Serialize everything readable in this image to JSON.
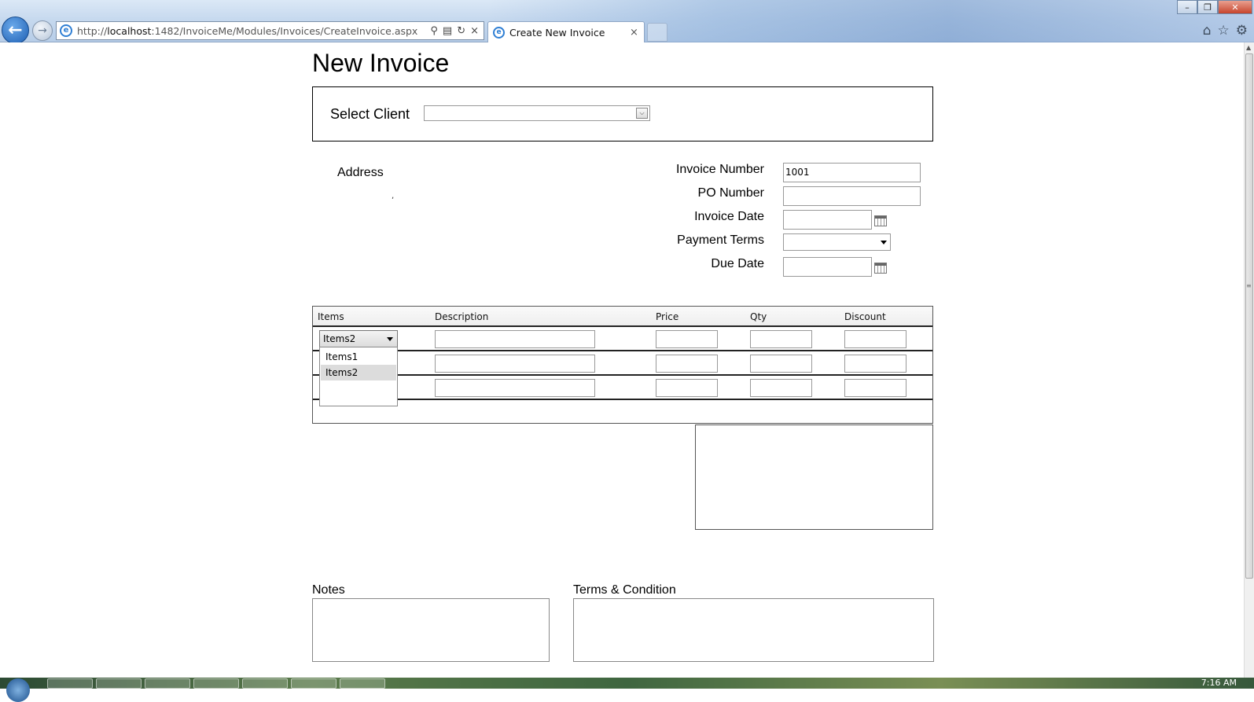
{
  "browser": {
    "url_prefix": "http://",
    "url_host": "localhost",
    "url_rest": ":1482/InvoiceMe/Modules/Invoices/CreateInvoice.aspx",
    "tab_title": "Create New Invoice",
    "tab_close": "×",
    "back_glyph": "←",
    "forward_glyph": "→",
    "search_glyph": "⚲",
    "refresh_glyph": "↻",
    "stop_glyph": "×",
    "home_glyph": "⌂",
    "favorites_glyph": "☆",
    "tools_glyph": "⚙"
  },
  "window": {
    "minimize": "–",
    "maximize": "❐",
    "close": "✕"
  },
  "taskbar": {
    "clock": "7:16 AM"
  },
  "page": {
    "title": "New Invoice"
  },
  "client": {
    "label": "Select Client",
    "selected": ""
  },
  "address": {
    "label": "Address",
    "value": ","
  },
  "invoice": {
    "number_label": "Invoice Number",
    "number_value": "1001",
    "po_label": "PO Number",
    "po_value": "",
    "date_label": "Invoice Date",
    "date_value": "",
    "terms_label": "Payment Terms",
    "terms_value": "",
    "due_label": "Due Date",
    "due_value": ""
  },
  "grid": {
    "columns": [
      "Items",
      "Description",
      "Price",
      "Qty",
      "Discount"
    ],
    "selected_item": "Items2",
    "dropdown_options": [
      "Items1",
      "Items2"
    ]
  },
  "notes": {
    "label": "Notes",
    "value": ""
  },
  "terms": {
    "label": "Terms & Condition",
    "value": ""
  },
  "colors": {
    "dropdown_highlight": "#dcdcdc",
    "chrome_accent": "#2f7fd4"
  }
}
